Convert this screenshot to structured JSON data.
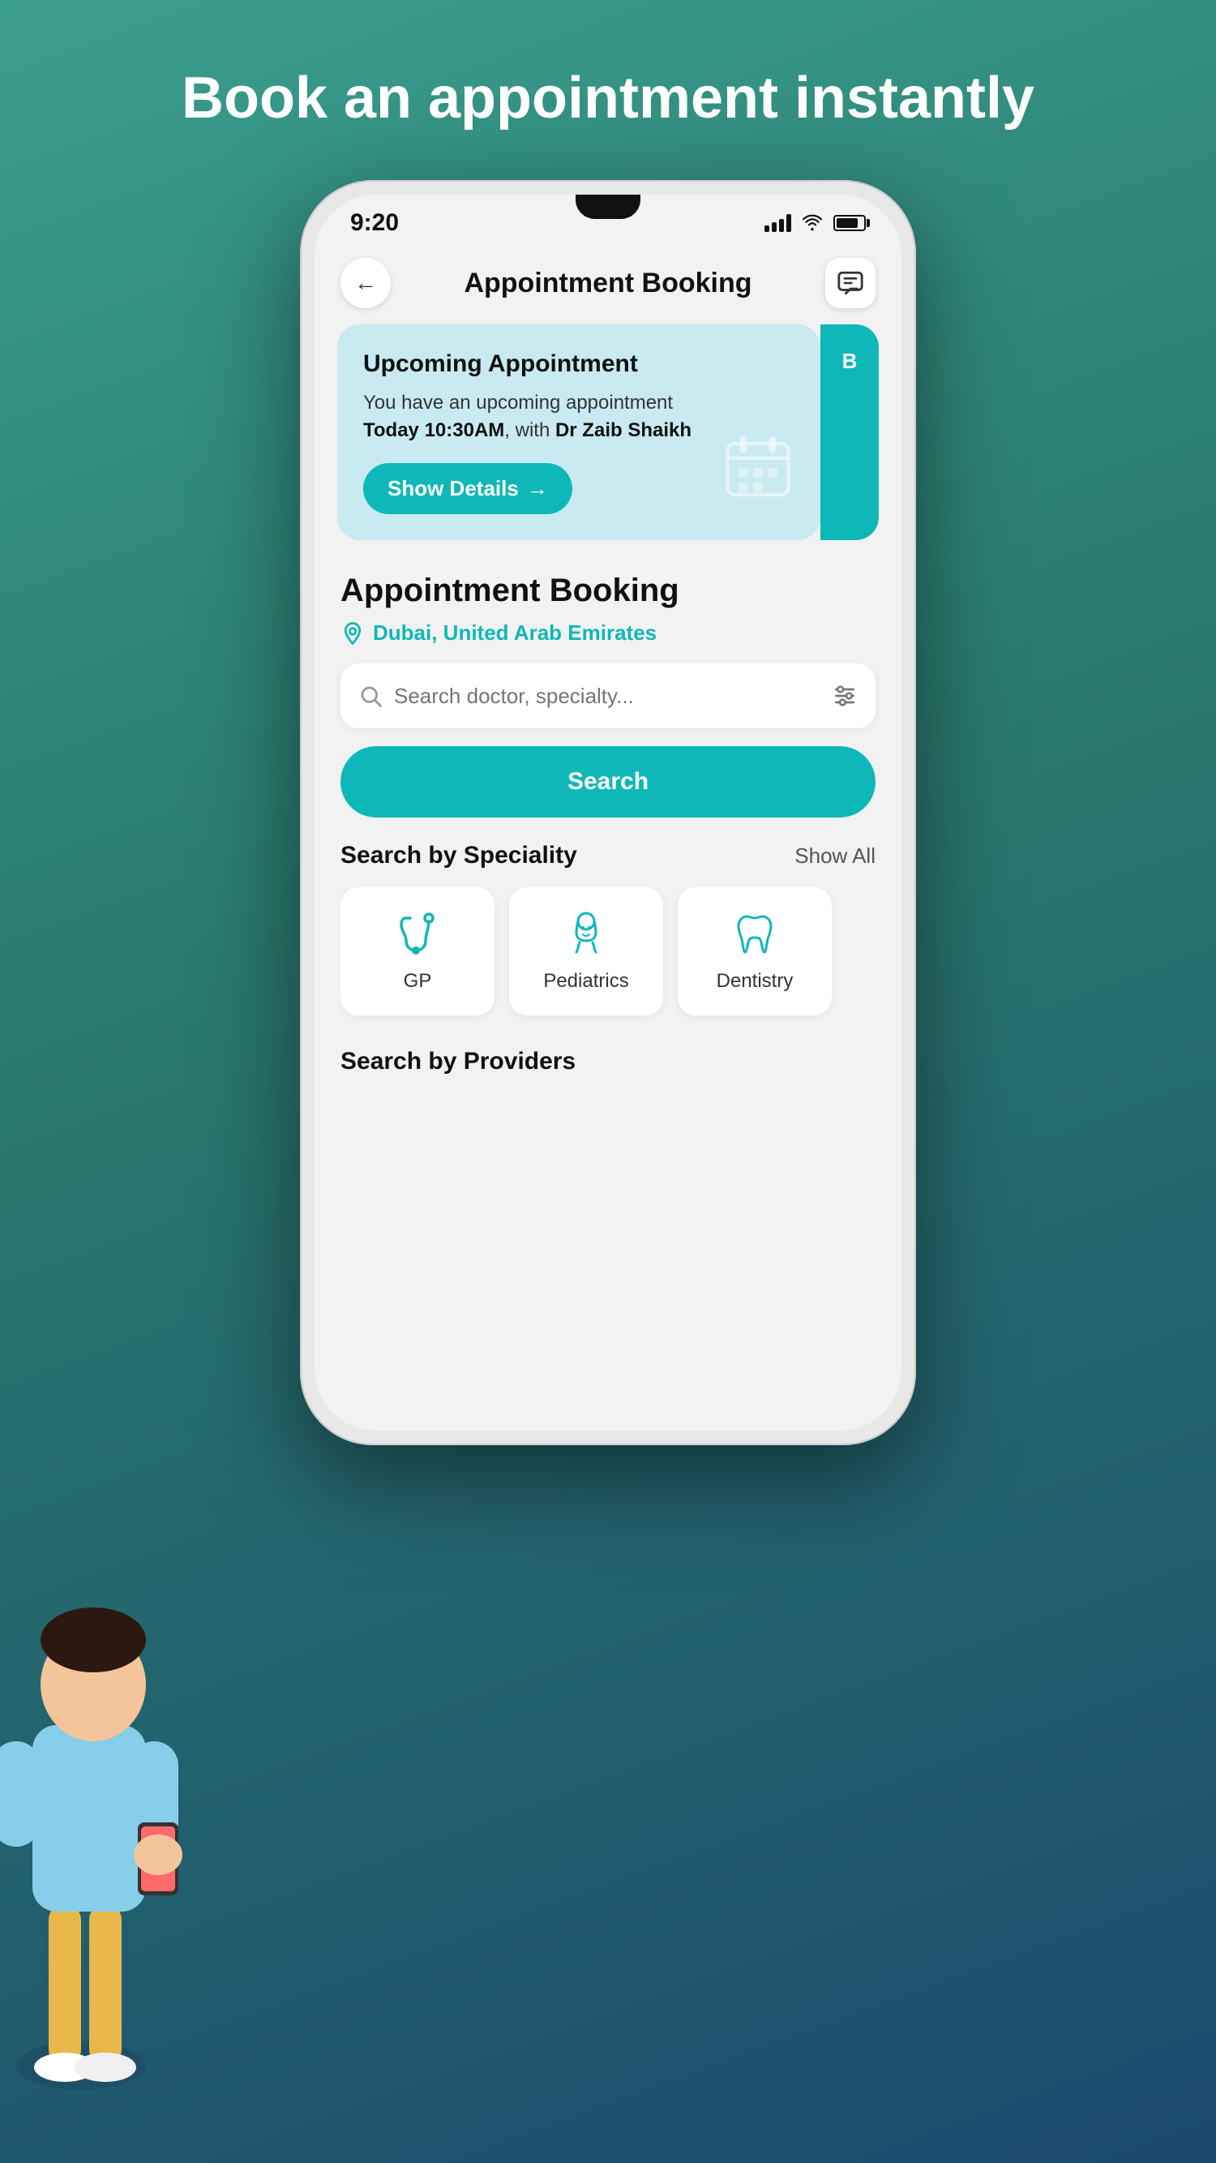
{
  "page": {
    "headline": "Book an appointment instantly",
    "background_gradient_start": "#3a9e8e",
    "background_gradient_end": "#1a4a6e"
  },
  "status_bar": {
    "time": "9:20",
    "signal_bars": 4,
    "wifi": true,
    "battery_percent": 80
  },
  "header": {
    "title": "Appointment Booking",
    "back_label": "←",
    "message_icon_label": "messages"
  },
  "upcoming_card": {
    "title": "Upcoming Appointment",
    "description": "You have an upcoming appointment",
    "appointment_time": "Today 10:30AM",
    "appointment_with_label": ", with ",
    "doctor_name": "Dr Zaib Shaikh",
    "show_details_label": "Show Details",
    "arrow": "→"
  },
  "booking": {
    "section_title": "Appointment Booking",
    "location": "Dubai, United Arab Emirates",
    "search_placeholder": "Search doctor, specialty...",
    "search_button_label": "Search"
  },
  "speciality": {
    "section_title": "Search by Speciality",
    "show_all_label": "Show All",
    "items": [
      {
        "id": "gp",
        "label": "GP",
        "icon": "stethoscope"
      },
      {
        "id": "pediatrics",
        "label": "Pediatrics",
        "icon": "baby"
      },
      {
        "id": "dentistry",
        "label": "Dentistry",
        "icon": "tooth"
      }
    ]
  },
  "providers": {
    "section_title": "Search by Providers"
  },
  "colors": {
    "teal": "#0fb8b8",
    "light_blue_card": "#c8eaf0",
    "text_dark": "#111111",
    "text_muted": "#777777"
  }
}
